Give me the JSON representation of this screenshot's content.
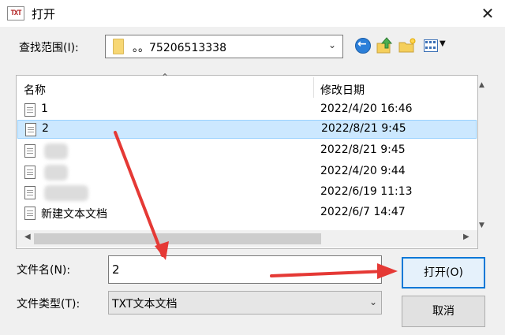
{
  "window": {
    "title": "打开",
    "app_icon_text": "TXT",
    "close_glyph": "✕"
  },
  "lookin": {
    "label": "查找范围(I):",
    "value": "。。75206513338",
    "icon": "folder-icon"
  },
  "toolbar": {
    "icons": [
      "back-icon",
      "up-folder-icon",
      "new-folder-icon",
      "views-menu-icon"
    ]
  },
  "list": {
    "columns": {
      "name": "名称",
      "date": "修改日期"
    },
    "rows": [
      {
        "name": "1",
        "date": "2022/4/20 16:46",
        "selected": false,
        "name_blurred": false
      },
      {
        "name": "2",
        "date": "2022/8/21 9:45",
        "selected": true,
        "name_blurred": false
      },
      {
        "name": "",
        "date": "2022/8/21 9:45",
        "selected": false,
        "name_blurred": true
      },
      {
        "name": "",
        "date": "2022/4/20 9:44",
        "selected": false,
        "name_blurred": true
      },
      {
        "name": "",
        "date": "2022/6/19 11:13",
        "selected": false,
        "name_blurred": true
      },
      {
        "name": "新建文本文档",
        "date": "2022/6/7 14:47",
        "selected": false,
        "name_blurred": false
      }
    ]
  },
  "filename": {
    "label": "文件名(N):",
    "value": "2"
  },
  "filetype": {
    "label": "文件类型(T):",
    "value": "TXT文本文档"
  },
  "buttons": {
    "open": "打开(O)",
    "cancel": "取消"
  },
  "colors": {
    "selection": "#cce8ff",
    "default_button_border": "#0078d7",
    "annotation_arrow": "#e53935"
  }
}
